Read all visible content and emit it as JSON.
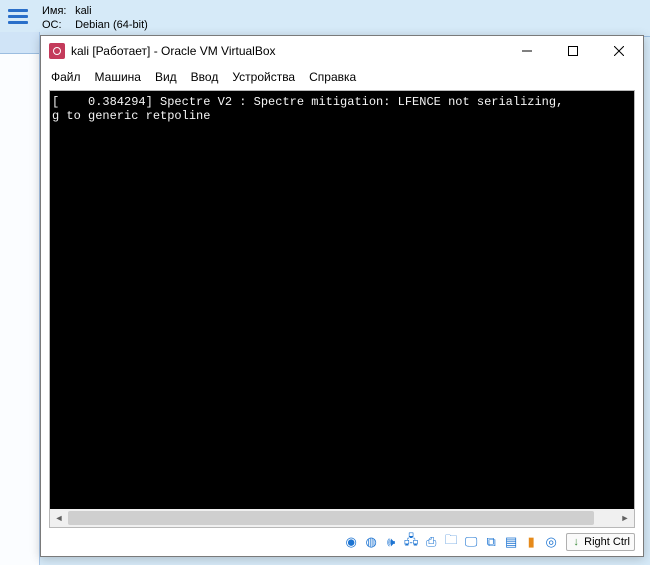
{
  "manager": {
    "name_label": "Имя:",
    "name_value": "kali",
    "os_label": "ОС:",
    "os_value": "Debian (64-bit)"
  },
  "window": {
    "title": "kali [Работает] - Oracle VM VirtualBox"
  },
  "menu": {
    "file": "Файл",
    "machine": "Машина",
    "view": "Вид",
    "input": "Ввод",
    "devices": "Устройства",
    "help": "Справка"
  },
  "console": {
    "line1": "[    0.384294] Spectre V2 : Spectre mitigation: LFENCE not serializing, ",
    "line2": "g to generic retpoline"
  },
  "status": {
    "hostkey": "Right Ctrl"
  }
}
